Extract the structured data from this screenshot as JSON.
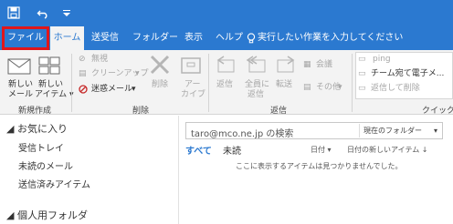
{
  "titlebar": {
    "qa_icons": [
      "save-icon",
      "undo-icon",
      "dropdown-icon"
    ]
  },
  "tabs": [
    {
      "label": "ファイル",
      "name": "tab-file",
      "selected": false,
      "highlighted": true
    },
    {
      "label": "ホーム",
      "name": "tab-home",
      "selected": true
    },
    {
      "label": "送受信",
      "name": "tab-send-receive"
    },
    {
      "label": "フォルダー",
      "name": "tab-folder"
    },
    {
      "label": "表示",
      "name": "tab-view"
    },
    {
      "label": "ヘルプ",
      "name": "tab-help"
    }
  ],
  "tell_me": "実行したい作業を入力してください",
  "ribbon": {
    "new_group": {
      "new_mail_1": "新しい",
      "new_mail_2": "メール",
      "new_item_1": "新しい",
      "new_item_2": "アイテム",
      "label": "新規作成"
    },
    "delete_group": {
      "ignore": "無視",
      "cleanup": "クリーンアップ",
      "junk": "迷惑メール",
      "delete": "削除",
      "archive_1": "アー",
      "archive_2": "カイブ",
      "label": "削除"
    },
    "respond_group": {
      "reply": "返信",
      "reply_all_1": "全員に",
      "reply_all_2": "返信",
      "forward": "転送",
      "meeting": "会議",
      "more": "その他",
      "label": "返信"
    },
    "quick_steps": {
      "item1": "ping",
      "item2": "チーム宛て電子メ...",
      "item3": "返信して削除",
      "label": "クイック操"
    }
  },
  "nav": {
    "favorites": "お気に入り",
    "items": [
      "受信トレイ",
      "未読のメール",
      "送信済みアイテム"
    ],
    "personal": "個人用フォルダ"
  },
  "main": {
    "search_placeholder": "taro@mco.ne.jp の検索",
    "scope": "現在のフォルダー",
    "filter_all": "すべて",
    "filter_unread": "未読",
    "sort_date": "日付",
    "sort_newest": "日付の新しいアイテム",
    "empty_message": "ここに表示するアイテムは見つかりませんでした。"
  },
  "colors": {
    "accent": "#2b79d0",
    "highlight": "#e0161b"
  }
}
